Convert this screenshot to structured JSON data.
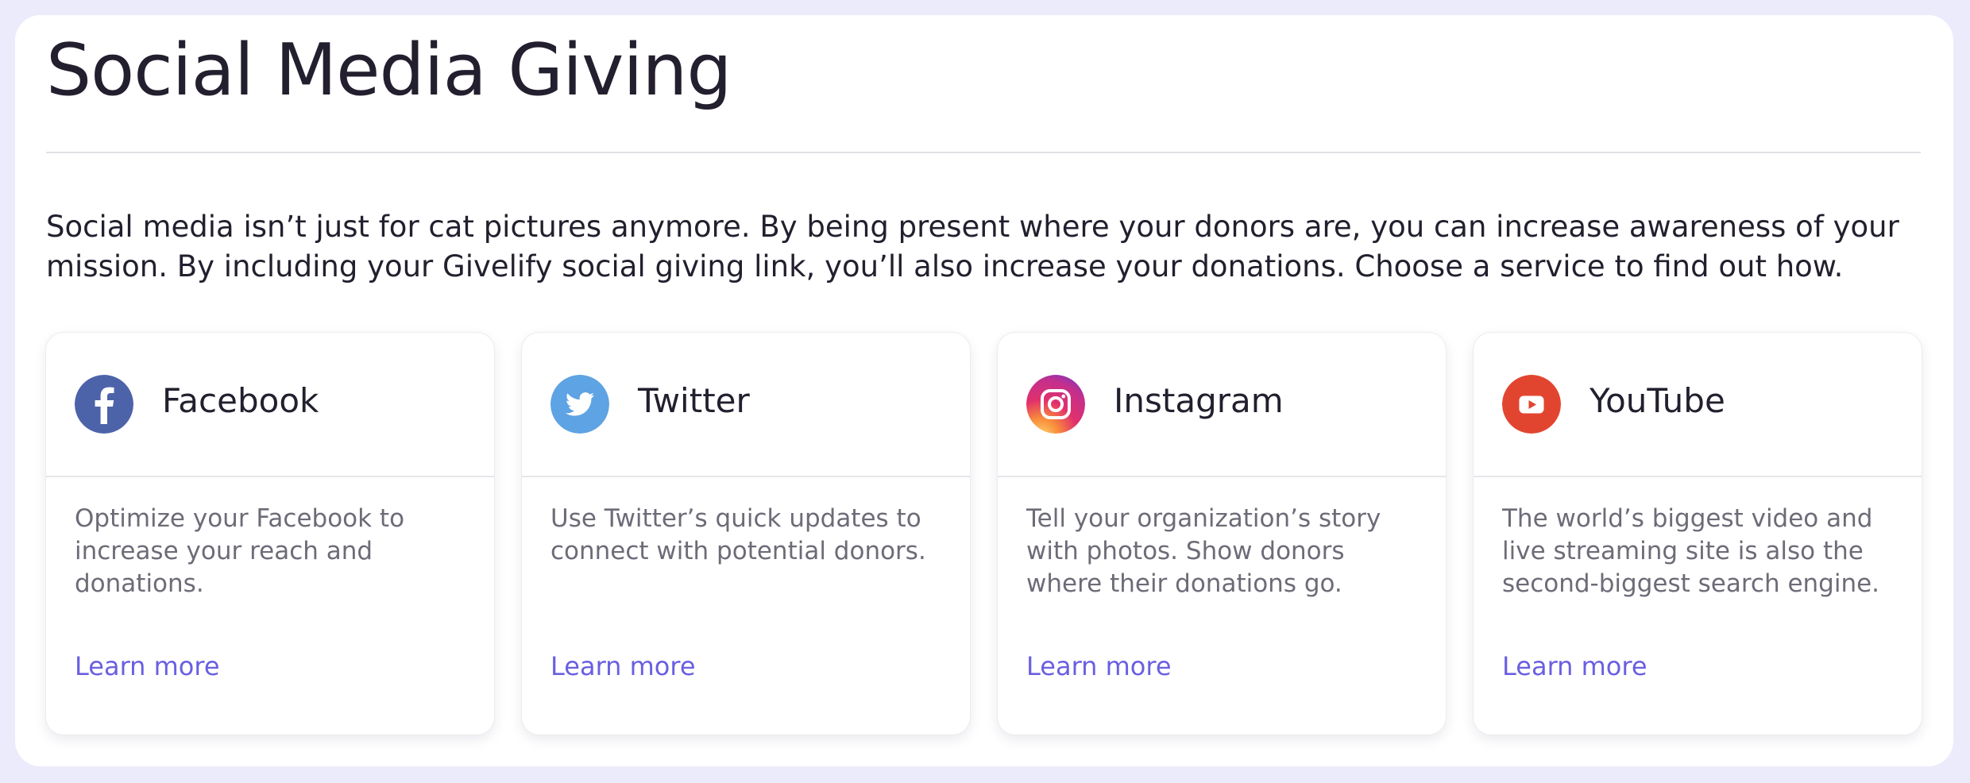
{
  "page": {
    "title": "Social Media Giving",
    "intro": "Social media isn’t just for cat pictures anymore. By being present where your donors are, you can increase awareness of your mission. By including your Givelify social giving link, you’ll also increase your donations. Choose a service to find out how."
  },
  "colors": {
    "page_background": "#ecebfb",
    "panel": "#ffffff",
    "text": "#231f2e",
    "muted_text": "#6e6b78",
    "link": "#6a5fe0",
    "facebook": "#4d63a9",
    "twitter": "#5ea3e3",
    "youtube": "#e2452f"
  },
  "cards": [
    {
      "name": "Facebook",
      "icon": "facebook-icon",
      "description": "Optimize your Facebook to increase your reach and donations.",
      "link_label": "Learn more"
    },
    {
      "name": "Twitter",
      "icon": "twitter-icon",
      "description": "Use Twitter’s quick updates to connect with potential donors.",
      "link_label": "Learn more"
    },
    {
      "name": "Instagram",
      "icon": "instagram-icon",
      "description": "Tell your organization’s story with photos. Show donors where their donations go.",
      "link_label": "Learn more"
    },
    {
      "name": "YouTube",
      "icon": "youtube-icon",
      "description": "The world’s biggest video and live streaming site is also the second-biggest search engine.",
      "link_label": "Learn more"
    }
  ]
}
